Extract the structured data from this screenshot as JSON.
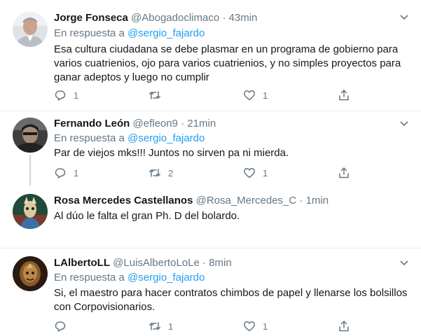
{
  "tweets": [
    {
      "name": "Jorge Fonseca",
      "handle": "@Abogadoclimaco",
      "sep": "·",
      "time": "43min",
      "reply_prefix": "En respuesta a ",
      "reply_to": "@sergio_fajardo",
      "text": "Esa cultura ciudadana se debe plasmar en un programa de gobierno para varios cuatrienios, ojo para varios cuatrienios, y no simples proyectos para ganar adeptos y luego no cumplir",
      "replies": "1",
      "retweets": "",
      "likes": "1"
    },
    {
      "name": "Fernando León",
      "handle": "@efleon9",
      "sep": "·",
      "time": "21min",
      "reply_prefix": "En respuesta a ",
      "reply_to": "@sergio_fajardo",
      "text": "Par de viejos mks!!! Juntos no sirven pa ni mierda.",
      "replies": "1",
      "retweets": "2",
      "likes": "1"
    },
    {
      "name": "Rosa Mercedes Castellanos",
      "handle": "@Rosa_Mercedes_C",
      "sep": "·",
      "time": "1min",
      "text": "Al dúo le falta el gran Ph. D del bolardo."
    },
    {
      "name": "LAlbertoLL",
      "handle": "@LuisAlbertoLoLe",
      "sep": "·",
      "time": "8min",
      "reply_prefix": "En respuesta a ",
      "reply_to": "@sergio_fajardo",
      "text": "Si, el maestro para hacer contratos chimbos de papel y llenarse los bolsillos con Corpovisionarios.",
      "replies": "",
      "retweets": "1",
      "likes": "1"
    }
  ],
  "icons": {
    "reply": "reply-icon",
    "retweet": "retweet-icon",
    "like": "heart-icon",
    "share": "share-icon",
    "more": "chevron-down-icon"
  },
  "colors": {
    "mention": "#1da1f2",
    "secondary_text": "#657786",
    "divider": "#e6ecf0",
    "thread_line": "#ccd6dd"
  }
}
